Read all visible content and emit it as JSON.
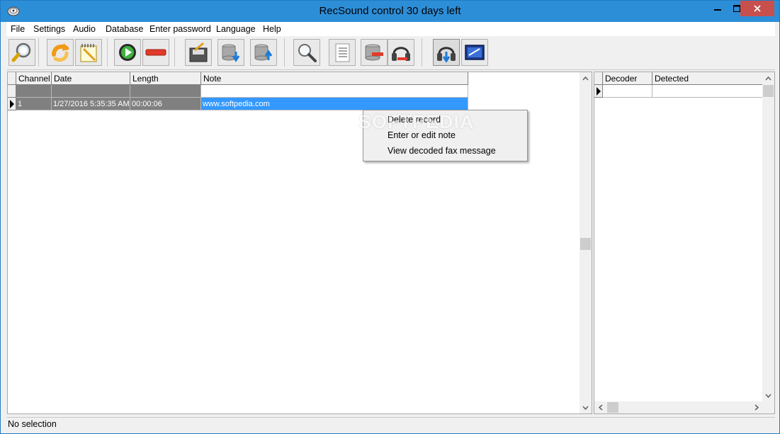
{
  "window": {
    "title": "RecSound control 30 days left"
  },
  "menu": [
    "File",
    "Settings",
    "Audio",
    "Database",
    "Enter password",
    "Language",
    "Help"
  ],
  "toolbar_icons": [
    "magnifier-search-icon",
    "refresh-arrow-icon",
    "notepad-pencil-icon",
    "play-icon",
    "stop-minus-icon",
    "save-disk-icon",
    "database-download-icon",
    "database-upload-icon",
    "zoom-icon",
    "list-document-icon",
    "database-remove-icon",
    "headphones-record-icon",
    "headphones-listen-icon",
    "monitor-screen-icon"
  ],
  "records_table": {
    "columns": [
      "Channel",
      "Date",
      "Length",
      "Note"
    ],
    "rows": [
      {
        "channel": "",
        "date": "",
        "length": "",
        "note": ""
      },
      {
        "channel": "1",
        "date": "1/27/2016 5:35:35 AM",
        "length": "00:00:06",
        "note": "www.softpedia.com"
      }
    ]
  },
  "context_menu": [
    "Delete record",
    "Enter or edit note",
    "View decoded fax message"
  ],
  "watermark": "SOFTPEDIA",
  "decoder_table": {
    "columns": [
      "Decoder",
      "Detected"
    ]
  },
  "status": {
    "text": "No selection"
  },
  "colors": {
    "titlebar": "#2d8ed8",
    "close": "#c7504d",
    "selection": "#3399ff",
    "header_dark": "#808080"
  }
}
